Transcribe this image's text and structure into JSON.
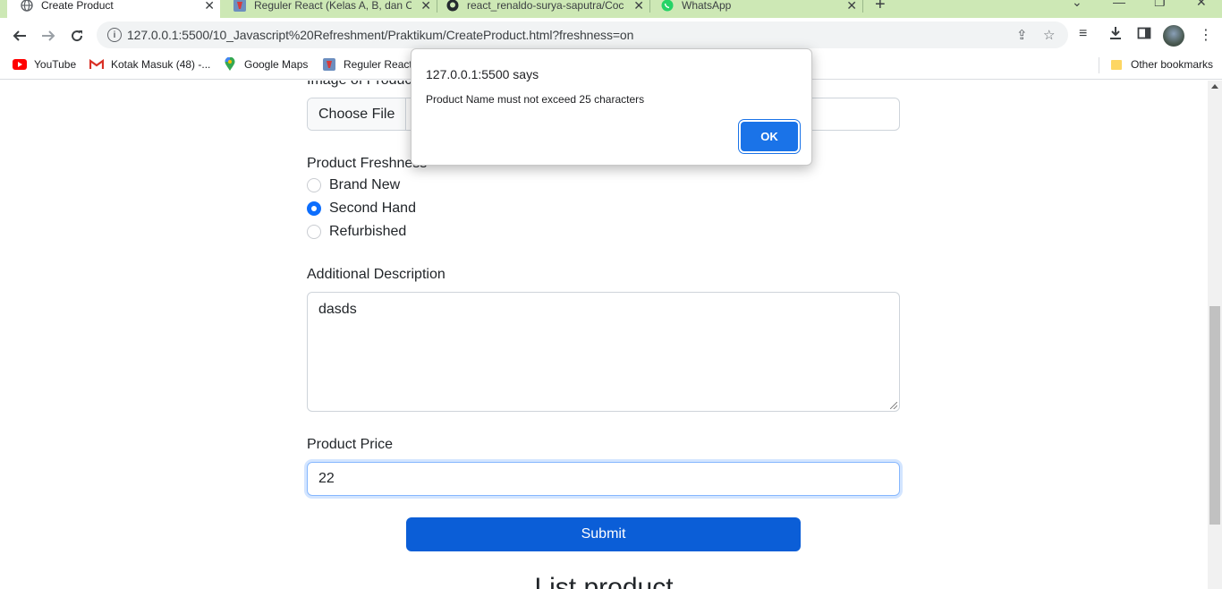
{
  "tabs": [
    {
      "title": "Create Product",
      "active": true,
      "icon": "globe-icon"
    },
    {
      "title": "Reguler React (Kelas A, B, dan C)",
      "active": false,
      "icon": "react-course-icon"
    },
    {
      "title": "react_renaldo-surya-saputra/Coc",
      "active": false,
      "icon": "github-icon"
    },
    {
      "title": "WhatsApp",
      "active": false,
      "icon": "whatsapp-icon"
    }
  ],
  "toolbar": {
    "url": "127.0.0.1:5500/10_Javascript%20Refreshment/Praktikum/CreateProduct.html?freshness=on"
  },
  "bookmarks": {
    "items": [
      {
        "label": "YouTube",
        "icon": "youtube-icon"
      },
      {
        "label": "Kotak Masuk (48) -...",
        "icon": "gmail-icon"
      },
      {
        "label": "Google Maps",
        "icon": "maps-icon"
      },
      {
        "label": "Reguler React",
        "icon": "react-course-icon"
      }
    ],
    "other": "Other bookmarks"
  },
  "form": {
    "image_label": "Image of Product",
    "choose_file": "Choose File",
    "freshness_label": "Product Freshness",
    "freshness_options": [
      {
        "label": "Brand New",
        "checked": false
      },
      {
        "label": "Second Hand",
        "checked": true
      },
      {
        "label": "Refurbished",
        "checked": false
      }
    ],
    "description_label": "Additional Description",
    "description_value": "dasds",
    "price_label": "Product Price",
    "price_value": "22",
    "submit_label": "Submit",
    "list_title": "List product"
  },
  "dialog": {
    "title": "127.0.0.1:5500 says",
    "message": "Product Name must not exceed 25 characters",
    "ok_label": "OK"
  },
  "colors": {
    "tabstrip": "#cde8b5",
    "primary": "#0b5ed7",
    "dialog_button": "#1a73e8"
  }
}
